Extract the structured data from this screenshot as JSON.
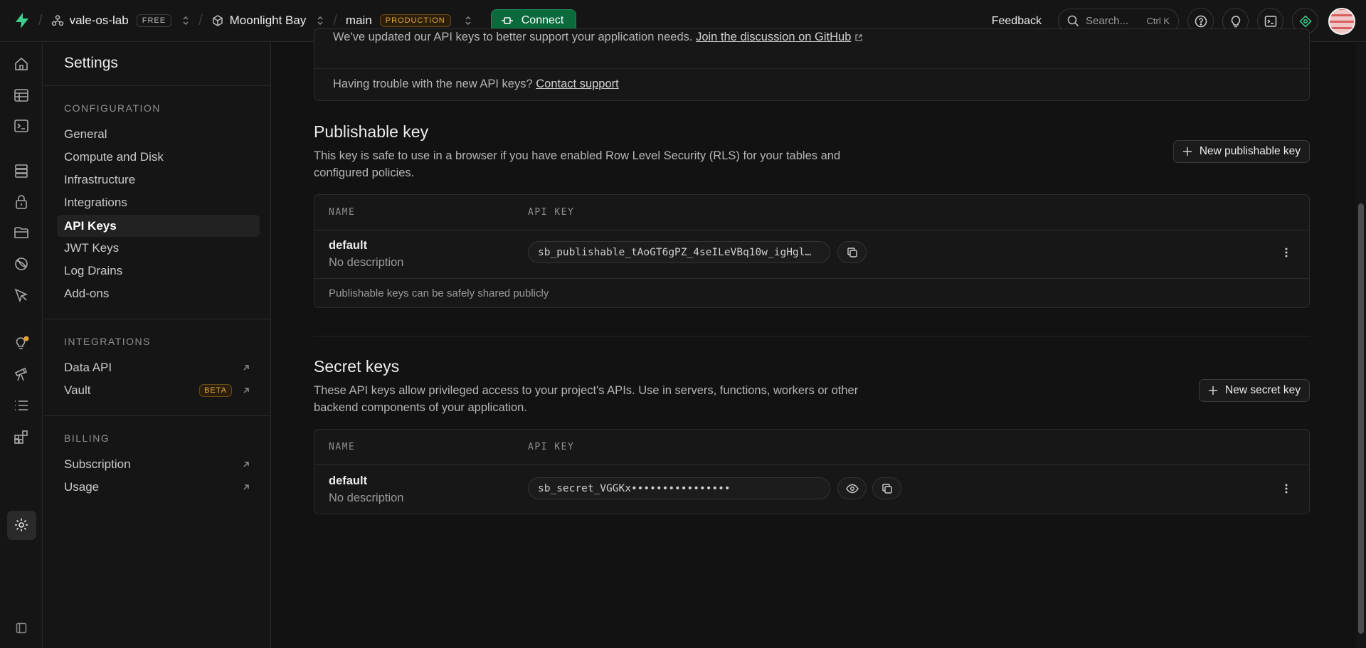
{
  "topbar": {
    "org": "vale-os-lab",
    "plan": "FREE",
    "project": "Moonlight Bay",
    "branch": "main",
    "env": "PRODUCTION",
    "connect": "Connect",
    "feedback": "Feedback",
    "search_placeholder": "Search...",
    "search_shortcut": "Ctrl K"
  },
  "sidebar": {
    "title": "Settings",
    "sections": [
      {
        "heading": "CONFIGURATION",
        "items": [
          "General",
          "Compute and Disk",
          "Infrastructure",
          "Integrations",
          "API Keys",
          "JWT Keys",
          "Log Drains",
          "Add-ons"
        ]
      },
      {
        "heading": "INTEGRATIONS",
        "items": [
          "Data API",
          "Vault"
        ],
        "vault_badge": "BETA"
      },
      {
        "heading": "BILLING",
        "items": [
          "Subscription",
          "Usage"
        ]
      }
    ],
    "active_item": "API Keys"
  },
  "banner": {
    "line1_text": "We've updated our API keys to better support your application needs.",
    "line1_link": "Join the discussion on GitHub",
    "line2_text": "Having trouble with the new API keys?",
    "line2_link": "Contact support"
  },
  "publishable": {
    "title": "Publishable key",
    "description": "This key is safe to use in a browser if you have enabled Row Level Security (RLS) for your tables and configured policies.",
    "new_button": "New publishable key",
    "col_name": "NAME",
    "col_key": "API KEY",
    "row_name": "default",
    "row_desc": "No description",
    "row_key": "sb_publishable_tAoGT6gPZ_4seILeVBq10w_igHgl…",
    "note": "Publishable keys can be safely shared publicly"
  },
  "secret": {
    "title": "Secret keys",
    "description": "These API keys allow privileged access to your project's APIs. Use in servers, functions, workers or other backend components of your application.",
    "new_button": "New secret key",
    "col_name": "NAME",
    "col_key": "API KEY",
    "row_name": "default",
    "row_desc": "No description",
    "row_key": "sb_secret_VGGKx••••••••••••••••"
  },
  "colors": {
    "accent_green": "#0a6a3c",
    "production_orange": "#e5a53a",
    "background": "#121212"
  }
}
